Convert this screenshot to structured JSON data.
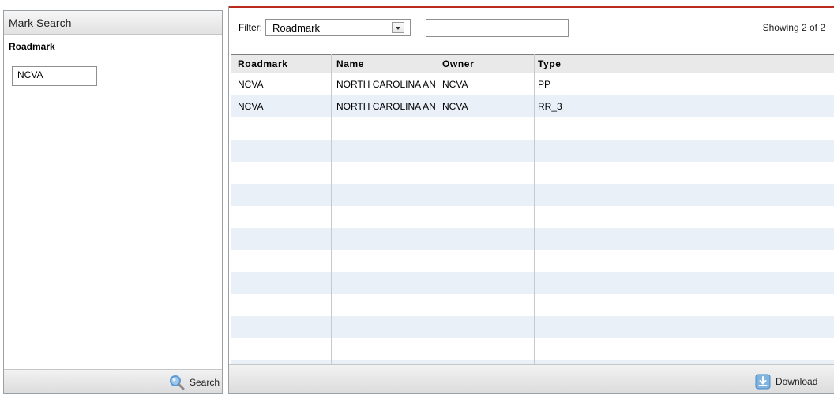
{
  "left_panel": {
    "title": "Mark Search",
    "field_label": "Roadmark",
    "field_value": "NCVA",
    "search_label": "Search"
  },
  "right_panel": {
    "filter_label": "Filter:",
    "filter_selected": "Roadmark",
    "filter_text_value": "",
    "showing": "Showing 2 of 2",
    "download_label": "Download"
  },
  "table": {
    "columns": [
      "Roadmark",
      "Name",
      "Owner",
      "Type"
    ],
    "rows": [
      [
        "NCVA",
        "NORTH CAROLINA AND VIRGINIA",
        "NCVA",
        "PP"
      ],
      [
        "NCVA",
        "NORTH CAROLINA AND VIRGINIA",
        "NCVA",
        "RR_3"
      ]
    ]
  },
  "colors": {
    "accent": "#b92a1f",
    "stripe": "#e9f0f8",
    "icon_blue": "#5b9bd5"
  }
}
